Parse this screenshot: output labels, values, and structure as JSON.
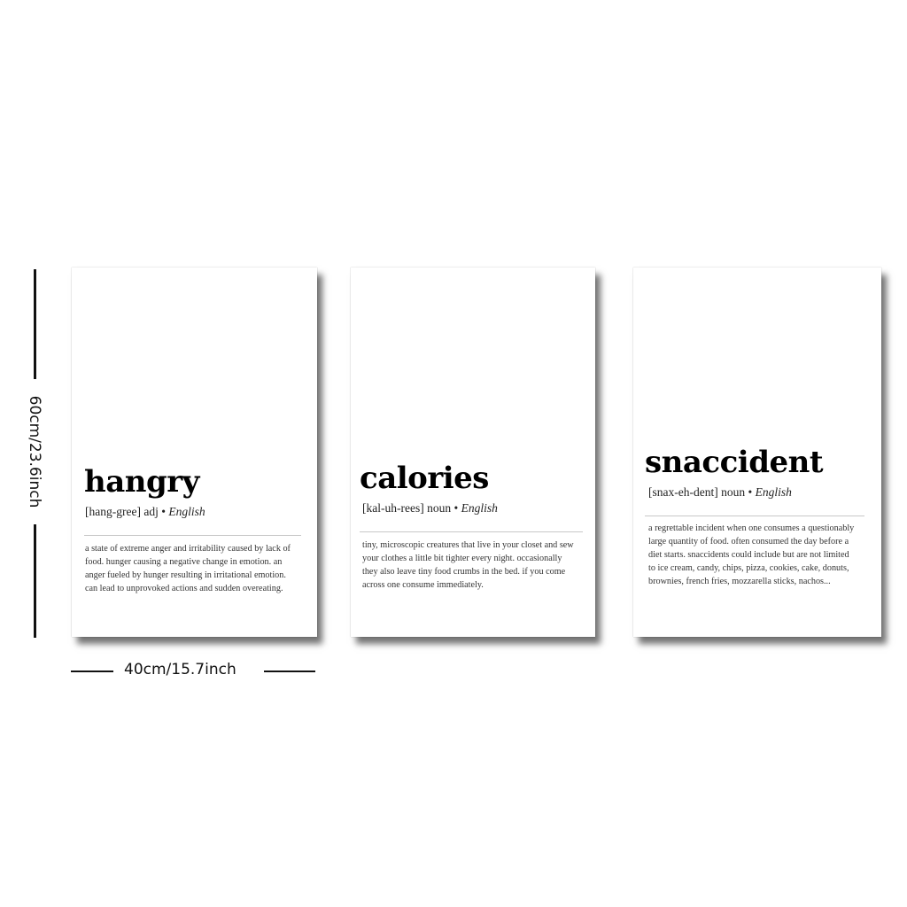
{
  "posters": [
    {
      "word": "hangry",
      "pronunciation": "[hang-gree]",
      "part_of_speech": "adj",
      "separator": "•",
      "language": "English",
      "definition": "a state of extreme anger and irritability caused by lack of food. hunger causing a negative change in emotion. an anger fueled by hunger resulting in irritational emotion. can lead to unprovoked actions and sudden overeating."
    },
    {
      "word": "calories",
      "pronunciation": "[kal-uh-rees]",
      "part_of_speech": "noun",
      "separator": "•",
      "language": "English",
      "definition": "tiny, microscopic creatures that live in your closet and sew your clothes a little bit tighter every night. occasionally they also leave tiny food crumbs in the bed. if you come across one consume immediately."
    },
    {
      "word": "snaccident",
      "pronunciation": "[snax-eh-dent]",
      "part_of_speech": "noun",
      "separator": "•",
      "language": "English",
      "definition": "a regrettable incident when one consumes a questionably large quantity of food. often consumed the day before a diet starts. snaccidents could include but are not limited to ice cream, candy, chips, pizza, cookies, cake, donuts, brownies, french fries, mozzarella sticks, nachos..."
    }
  ],
  "dimensions": {
    "height_label": "60cm/23.6inch",
    "width_label": "40cm/15.7inch"
  },
  "colors": {
    "background": "#ffffff",
    "text": "#000000",
    "rule": "#c8c8c8"
  }
}
